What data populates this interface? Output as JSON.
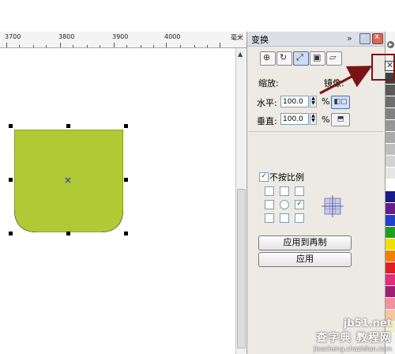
{
  "ruler": {
    "labels": [
      "3700",
      "3800",
      "3900",
      "4000"
    ],
    "unit": "毫米"
  },
  "docker": {
    "title": "变换",
    "more_glyph": "»",
    "scale_label": "缩放:",
    "mirror_label": "镜像:",
    "horizontal_label": "水平:",
    "horizontal_value": "100.0",
    "vertical_label": "垂直:",
    "vertical_value": "100.0",
    "percent": "%",
    "proportional_label": "不按比例",
    "proportional_checked": true,
    "apply_to_copy_label": "应用到再制",
    "apply_label": "应用"
  },
  "palette": {
    "no_color_glyph": "✕",
    "colors": [
      "#3f3f3f",
      "#5a5a5a",
      "#6e6e6e",
      "#828282",
      "#969696",
      "#aaaaaa",
      "#bebebe",
      "#d2d2d2",
      "#e6e6e6",
      "#ffffff",
      "#1a1a8c",
      "#6a1a8c",
      "#2040d0",
      "#20a020",
      "#f0e000",
      "#f08000",
      "#e02020",
      "#e0307a",
      "#a02070",
      "#f090a0",
      "#f5c6a0",
      "#f0f0d0"
    ]
  },
  "shape": {
    "fill": "#b1c934"
  },
  "watermark": {
    "site": "jb51.net",
    "brand": "查字典 教程网",
    "url": "jiaocheng.chazidian.com"
  }
}
